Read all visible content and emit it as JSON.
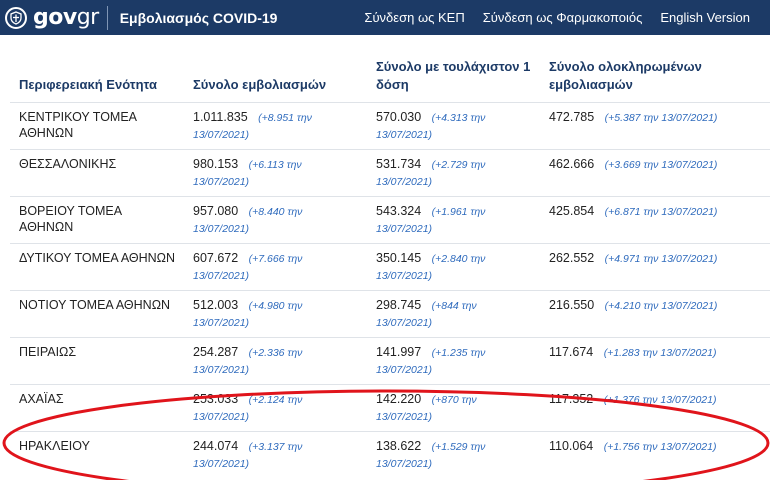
{
  "header": {
    "logo": "govgr",
    "logo_prefix": "gov",
    "logo_suffix": "gr",
    "title": "Εμβολιασμός COVID-19",
    "nav": [
      "Σύνδεση ως ΚΕΠ",
      "Σύνδεση ως Φαρμακοποιός",
      "English Version"
    ]
  },
  "table": {
    "columns": [
      "Περιφερειακή Ενότητα",
      "Σύνολο εμβολιασμών",
      "Σύνολο με τουλάχιστον 1 δόση",
      "Σύνολο ολοκληρωμένων εμβολιασμών"
    ],
    "rows": [
      {
        "region": "ΚΕΝΤΡΙΚΟΥ ΤΟΜΕΑ ΑΘΗΝΩΝ",
        "total": "1.011.835",
        "total_delta": "(+8.951 την 13/07/2021)",
        "one_dose": "570.030",
        "one_dose_delta": "(+4.313 την 13/07/2021)",
        "completed": "472.785",
        "completed_delta": "(+5.387 την 13/07/2021)"
      },
      {
        "region": "ΘΕΣΣΑΛΟΝΙΚΗΣ",
        "total": "980.153",
        "total_delta": "(+6.113 την 13/07/2021)",
        "one_dose": "531.734",
        "one_dose_delta": "(+2.729 την 13/07/2021)",
        "completed": "462.666",
        "completed_delta": "(+3.669 την 13/07/2021)"
      },
      {
        "region": "ΒΟΡΕΙΟΥ ΤΟΜΕΑ ΑΘΗΝΩΝ",
        "total": "957.080",
        "total_delta": "(+8.440 την 13/07/2021)",
        "one_dose": "543.324",
        "one_dose_delta": "(+1.961 την 13/07/2021)",
        "completed": "425.854",
        "completed_delta": "(+6.871 την 13/07/2021)"
      },
      {
        "region": "ΔΥΤΙΚΟΥ ΤΟΜΕΑ ΑΘΗΝΩΝ",
        "total": "607.672",
        "total_delta": "(+7.666 την 13/07/2021)",
        "one_dose": "350.145",
        "one_dose_delta": "(+2.840 την 13/07/2021)",
        "completed": "262.552",
        "completed_delta": "(+4.971 την 13/07/2021)"
      },
      {
        "region": "ΝΟΤΙΟΥ ΤΟΜΕΑ ΑΘΗΝΩΝ",
        "total": "512.003",
        "total_delta": "(+4.980 την 13/07/2021)",
        "one_dose": "298.745",
        "one_dose_delta": "(+844 την 13/07/2021)",
        "completed": "216.550",
        "completed_delta": "(+4.210 την 13/07/2021)"
      },
      {
        "region": "ΠΕΙΡΑΙΩΣ",
        "total": "254.287",
        "total_delta": "(+2.336 την 13/07/2021)",
        "one_dose": "141.997",
        "one_dose_delta": "(+1.235 την 13/07/2021)",
        "completed": "117.674",
        "completed_delta": "(+1.283 την 13/07/2021)"
      },
      {
        "region": "ΑΧΑΪΑΣ",
        "total": "253.033",
        "total_delta": "(+2.124 την 13/07/2021)",
        "one_dose": "142.220",
        "one_dose_delta": "(+870 την 13/07/2021)",
        "completed": "117.352",
        "completed_delta": "(+1.376 την 13/07/2021)"
      },
      {
        "region": "ΗΡΑΚΛΕΙΟΥ",
        "total": "244.074",
        "total_delta": "(+3.137 την 13/07/2021)",
        "one_dose": "138.622",
        "one_dose_delta": "(+1.529 την 13/07/2021)",
        "completed": "110.064",
        "completed_delta": "(+1.756 την 13/07/2021)"
      }
    ]
  },
  "colors": {
    "header_bg": "#1c3a66",
    "delta": "#2f6bbd",
    "annotation": "#e0141b"
  },
  "icons": {
    "emblem": "greek-coat-of-arms-icon"
  }
}
